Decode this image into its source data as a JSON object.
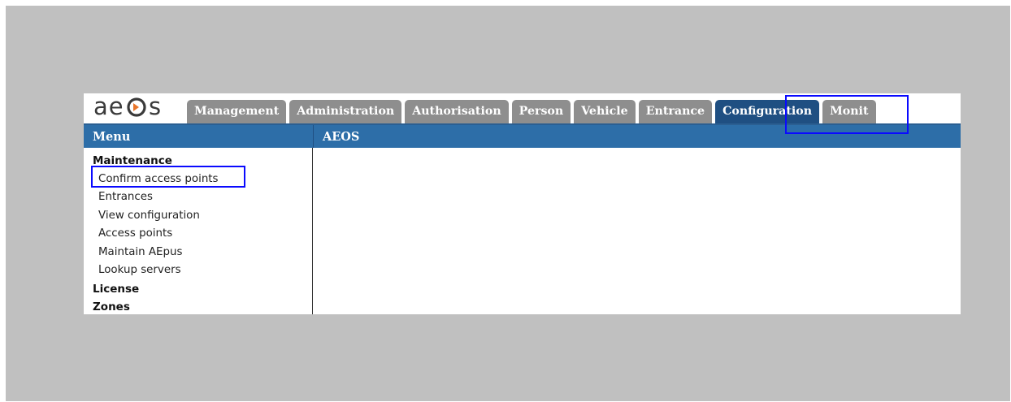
{
  "logo": {
    "text": "aeos",
    "colors": {
      "text": "#3a3a3a",
      "accent": "#e8752a"
    }
  },
  "tabs": [
    {
      "label": "Management",
      "active": false
    },
    {
      "label": "Administration",
      "active": false
    },
    {
      "label": "Authorisation",
      "active": false
    },
    {
      "label": "Person",
      "active": false
    },
    {
      "label": "Vehicle",
      "active": false
    },
    {
      "label": "Entrance",
      "active": false
    },
    {
      "label": "Configuration",
      "active": true
    },
    {
      "label": "Monit",
      "active": false
    }
  ],
  "menu": {
    "header": "Menu",
    "sections": [
      {
        "title": "Maintenance",
        "items": [
          "Confirm access points",
          "Entrances",
          "View configuration",
          "Access points",
          "Maintain AEpus",
          "Lookup servers"
        ]
      },
      {
        "title": "License",
        "items": []
      },
      {
        "title": "Zones",
        "items": []
      }
    ]
  },
  "content": {
    "header": "AEOS"
  },
  "colors": {
    "header_blue": "#2d6ea8",
    "active_tab": "#1f4f82",
    "inactive_tab": "#8e8e8e",
    "highlight": "#0a0aff",
    "backdrop": "#c0c0c0"
  }
}
